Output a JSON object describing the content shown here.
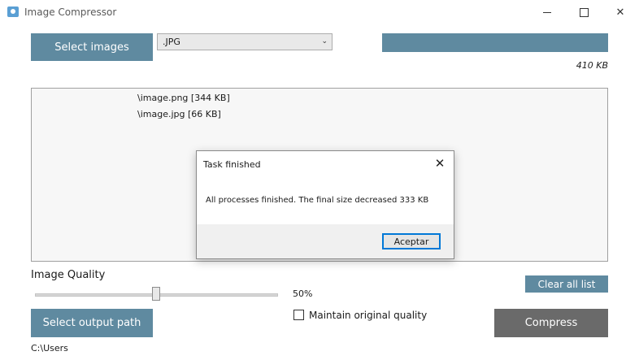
{
  "window": {
    "title": "Image Compressor",
    "icon": "camera-icon"
  },
  "toolbar": {
    "select_images_label": "Select images",
    "format_value": ".JPG",
    "progress_percent": 100,
    "total_size": "410 KB"
  },
  "files": [
    {
      "name": "\\image.png  [344 KB]"
    },
    {
      "name": "\\image.jpg  [66 KB]"
    }
  ],
  "controls": {
    "quality_label": "Image Quality",
    "quality_value": 50,
    "quality_percent_text": "50%",
    "clear_label": "Clear all list",
    "output_label": "Select output path",
    "maintain_label": "Maintain original quality",
    "maintain_checked": false,
    "compress_label": "Compress",
    "output_path": "C:\\Users"
  },
  "dialog": {
    "title": "Task finished",
    "message": "All processes finished. The final size decreased 333 KB",
    "ok_label": "Aceptar"
  },
  "colors": {
    "accent": "#5f8aa0",
    "compress_bg": "#6a6a6a",
    "focus": "#0078d7"
  }
}
